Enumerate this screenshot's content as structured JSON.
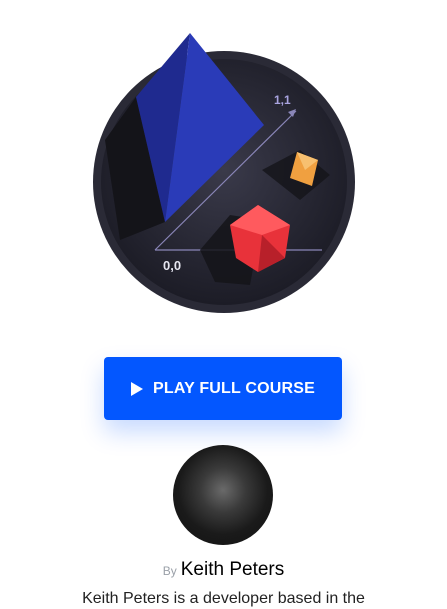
{
  "illustration": {
    "label_origin": "0,0",
    "label_end": "1,1"
  },
  "play_button": {
    "label": "PLAY FULL COURSE",
    "icon": "play-icon"
  },
  "instructor": {
    "by": "By",
    "name": "Keith Peters",
    "bio": "Keith Peters is a developer based in the"
  },
  "colors": {
    "accent": "#0357ff"
  }
}
